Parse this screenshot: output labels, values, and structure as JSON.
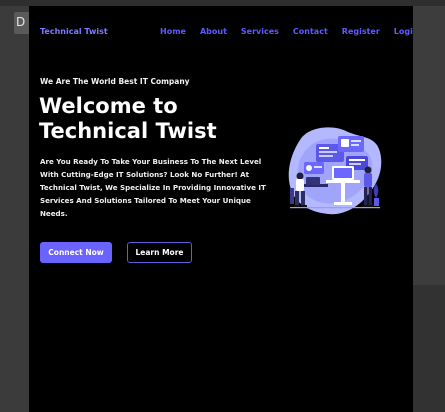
{
  "background": {
    "tab_label": "D"
  },
  "nav": {
    "brand": "Technical Twist",
    "links": [
      "Home",
      "About",
      "Services",
      "Contact",
      "Register",
      "Login"
    ]
  },
  "hero": {
    "tagline": "We Are The World Best IT Company",
    "headline_line1": "Welcome to",
    "headline_line2": "Technical Twist",
    "description": "Are You Ready To Take Your Business To The Next Level With Cutting-Edge IT Solutions? Look No Further! At Technical Twist, We Specialize In Providing Innovative IT Services And Solutions Tailored To Meet Your Unique Needs.",
    "primary_button": "Connect Now",
    "secondary_button": "Learn More"
  },
  "colors": {
    "accent": "#6a63ff",
    "nav_link": "#5d5bff",
    "page_bg": "#000000"
  },
  "icons": {
    "illustration": "it-team-illustration"
  }
}
